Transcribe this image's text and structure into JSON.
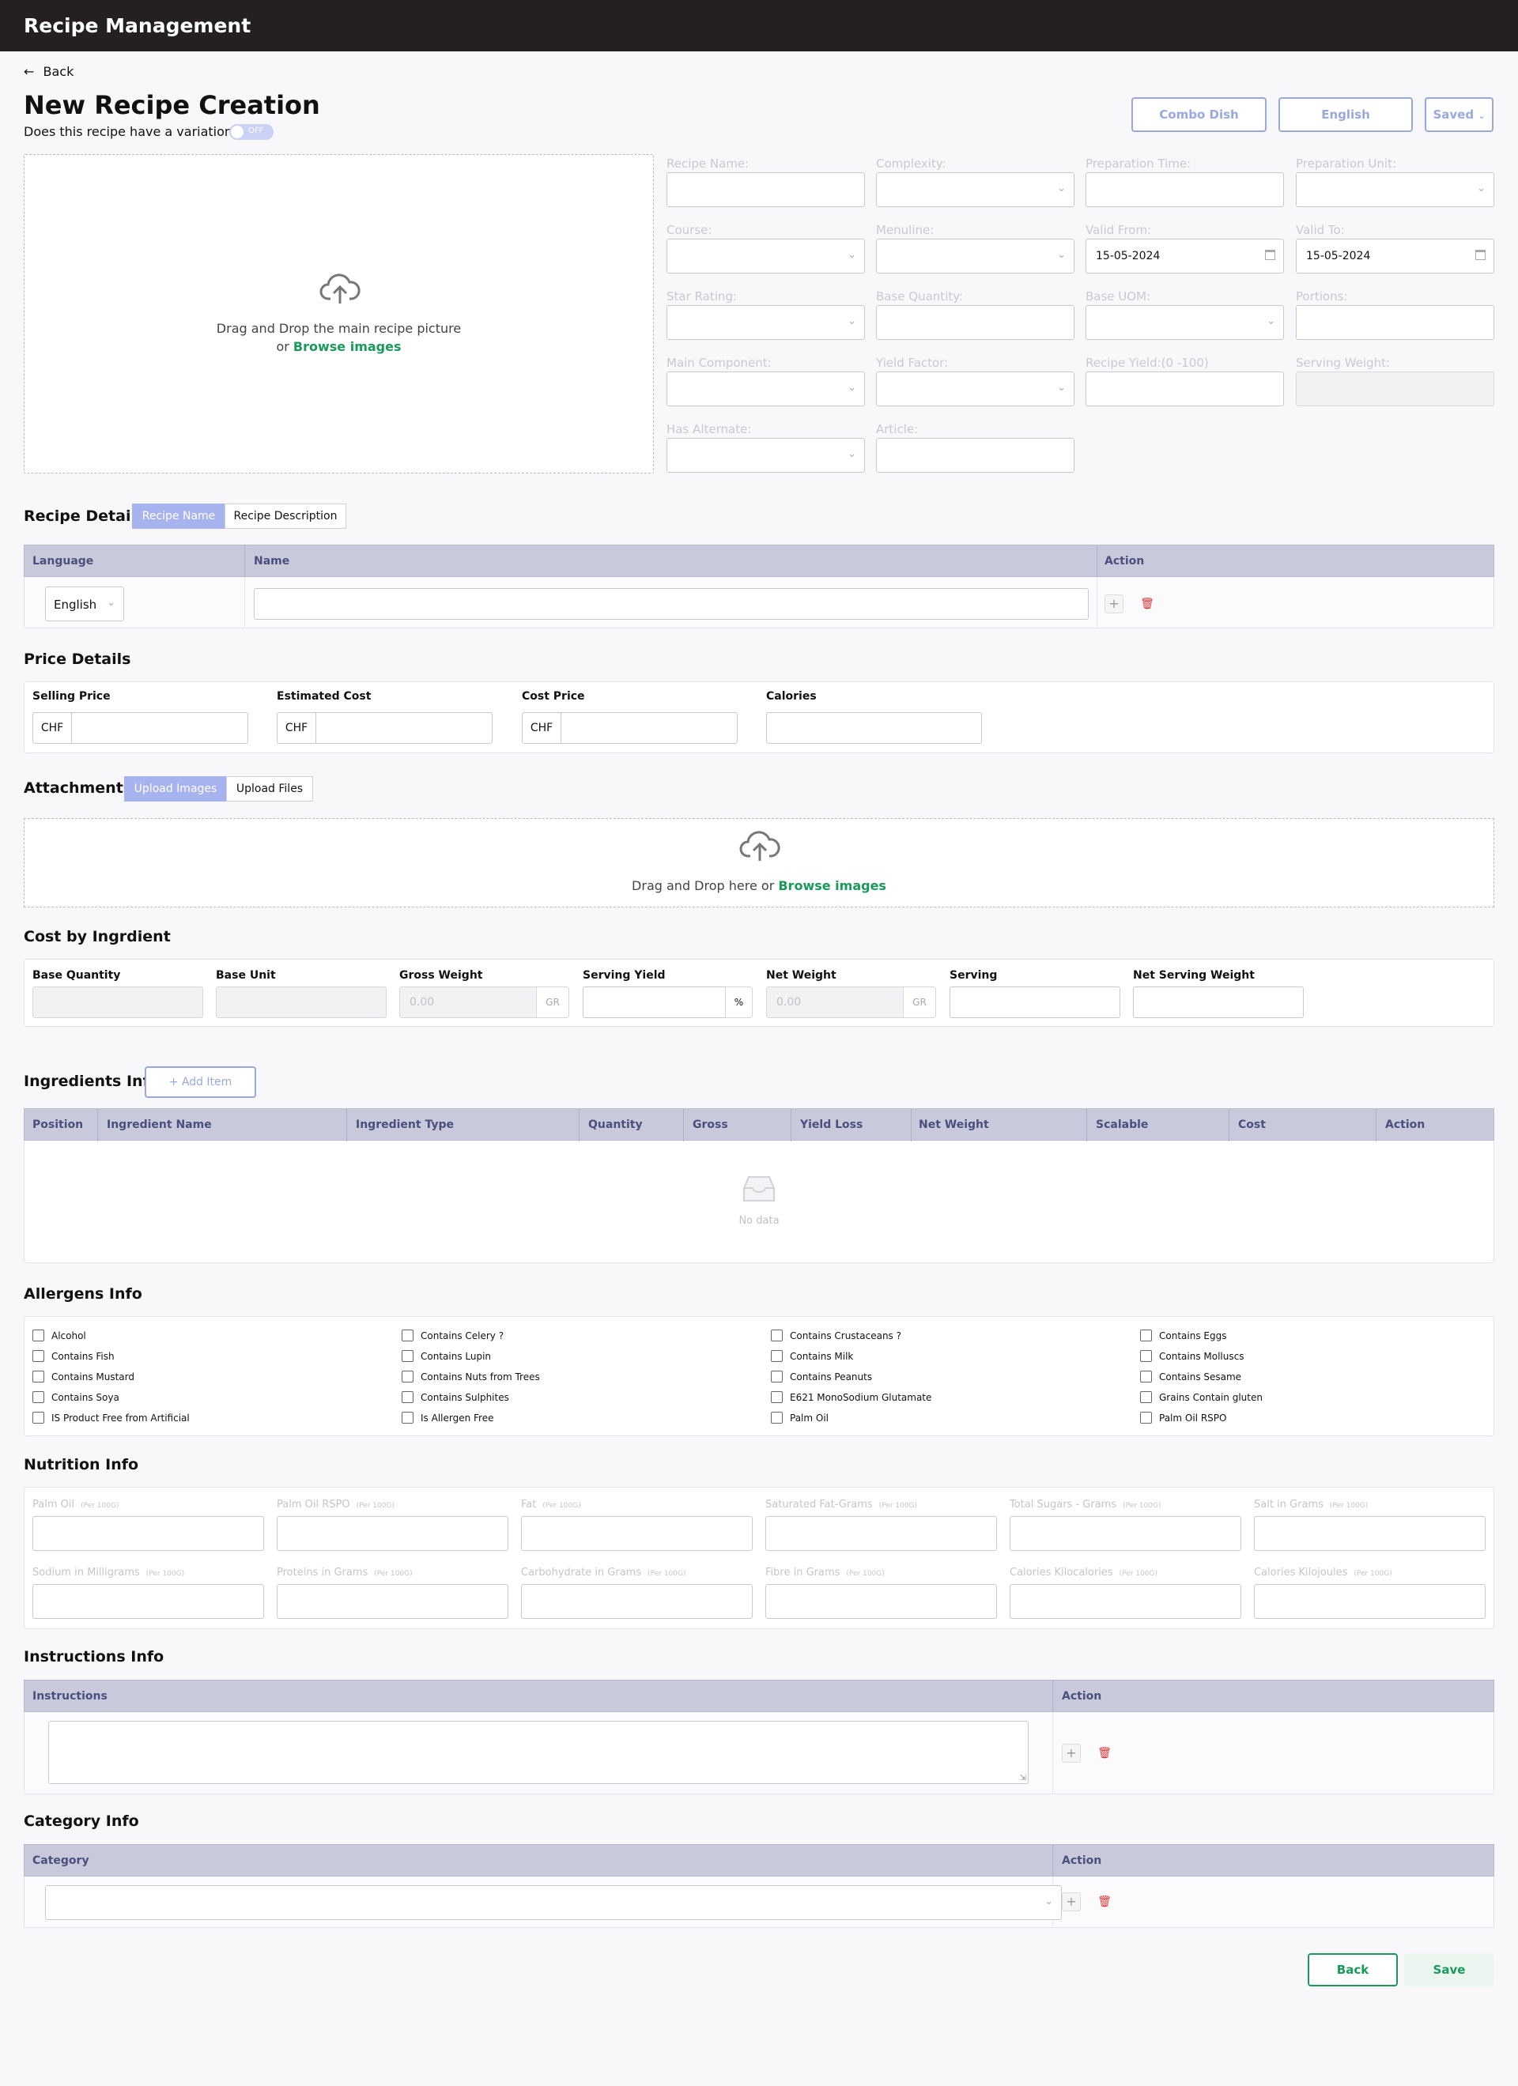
{
  "header": {
    "title": "Recipe Management"
  },
  "nav": {
    "back": "Back",
    "arrow": "←"
  },
  "page": {
    "title": "New Recipe Creation",
    "variation_label": "Does this recipe have a variation",
    "variation_toggle": "OFF"
  },
  "top_buttons": {
    "combo": "Combo Dish",
    "language": "English",
    "saved": "Saved"
  },
  "upload_main": {
    "line1": "Drag and Drop the main recipe picture",
    "or": "or ",
    "browse": "Browse images"
  },
  "form": {
    "recipe_name": "Recipe Name:",
    "complexity": "Complexity:",
    "prep_time": "Preparation Time:",
    "prep_unit": "Preparation Unit:",
    "course": "Course:",
    "menuline": "Menuline:",
    "valid_from": "Valid From:",
    "valid_from_value": "15-05-2024",
    "valid_to": "Valid To:",
    "valid_to_value": "15-05-2024",
    "star_rating": "Star Rating:",
    "base_quantity": "Base Quantity:",
    "base_uom": "Base UOM:",
    "portions": "Portions:",
    "main_component": "Main Component:",
    "yield_factor": "Yield Factor:",
    "recipe_yield": "Recipe Yield:(0 -100)",
    "serving_weight": "Serving Weight:",
    "has_alternate": "Has Alternate:",
    "article": "Article:"
  },
  "recipe_details": {
    "title": "Recipe Details",
    "tabs": [
      "Recipe Name",
      "Recipe Description"
    ],
    "cols": [
      "Language",
      "Name",
      "Action"
    ],
    "language_value": "English"
  },
  "price": {
    "title": "Price Details",
    "selling": "Selling Price",
    "estimated": "Estimated Cost",
    "cost": "Cost Price",
    "calories": "Calories",
    "currency": "CHF"
  },
  "attachments": {
    "title": "Attachments",
    "tabs": [
      "Upload Images",
      "Upload Files"
    ],
    "drop": "Drag and Drop here or ",
    "browse": "Browse images"
  },
  "cost_ingredient": {
    "title": "Cost by Ingrdient",
    "base_quantity": "Base Quantity",
    "base_unit": "Base Unit",
    "gross_weight": "Gross Weight",
    "gross_value": "0.00",
    "gross_unit": "GR",
    "serving_yield": "Serving Yield",
    "serving_yield_unit": "%",
    "net_weight": "Net Weight",
    "net_value": "0.00",
    "net_unit": "GR",
    "serving": "Serving",
    "net_serving_weight": "Net Serving Weight"
  },
  "ingredients": {
    "title": "Ingredients Info",
    "add": "+ Add Item",
    "cols": [
      "Position",
      "Ingredient Name",
      "Ingredient Type",
      "Quantity",
      "Gross",
      "Yield Loss",
      "Net Weight",
      "Scalable",
      "Cost",
      "Action"
    ],
    "empty": "No data"
  },
  "allergens": {
    "title": "Allergens Info",
    "items": [
      "Alcohol",
      "Contains Celery ?",
      "Contains Crustaceans ?",
      "Contains Eggs",
      "Contains Fish",
      "Contains Lupin",
      "Contains Milk",
      "Contains Molluscs",
      "Contains Mustard",
      "Contains Nuts from Trees",
      "Contains Peanuts",
      "Contains Sesame",
      "Contains Soya",
      "Contains Sulphites",
      "E621 MonoSodium Glutamate",
      "Grains Contain gluten",
      "IS Product Free from Artificial",
      "Is Allergen Free",
      "Palm Oil",
      "Palm Oil RSPO"
    ]
  },
  "nutrition": {
    "title": "Nutrition Info",
    "per": "(Per 100G)",
    "items": [
      "Palm Oil",
      "Palm Oil RSPO",
      "Fat",
      "Saturated Fat-Grams",
      "Total Sugars - Grams",
      "Salt in Grams",
      "Sodium in Milligrams",
      "Proteins in Grams",
      "Carbohydrate in Grams",
      "Fibre in Grams",
      "Calories Kilocalories",
      "Calories Kilojoules"
    ]
  },
  "instructions": {
    "title": "Instructions Info",
    "cols": [
      "Instructions",
      "Action"
    ]
  },
  "category": {
    "title": "Category Info",
    "cols": [
      "Category",
      "Action"
    ]
  },
  "footer": {
    "back": "Back",
    "save": "Save"
  }
}
